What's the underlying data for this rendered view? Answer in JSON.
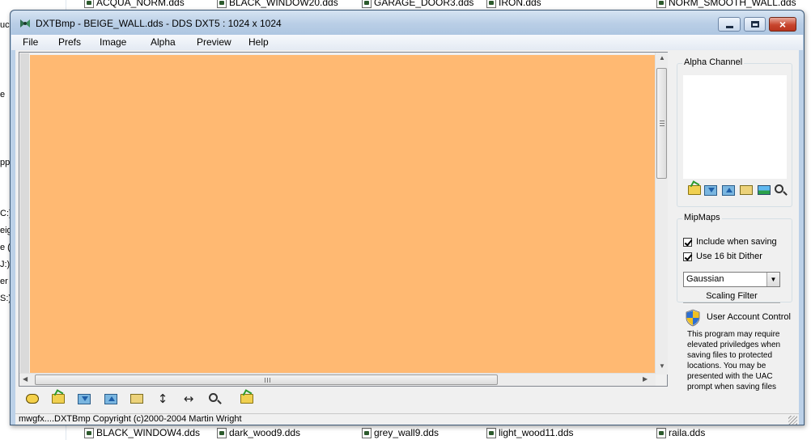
{
  "background": {
    "top_files": [
      "ACQUA_NORM.dds",
      "BLACK_WINDOW20.dds",
      "GARAGE_DOOR3.dds",
      "IRON.dds",
      "NORM_SMOOTH_WALL.dds"
    ],
    "bottom_files": [
      "BLACK_WINDOW4.dds",
      "dark_wood9.dds",
      "grey_wall9.dds",
      "light_wood11.dds",
      "raila.dds"
    ],
    "left_fragments": [
      "ucl",
      "e",
      "pp",
      "C:)",
      "eig",
      "e (",
      "J:)",
      "er",
      "S:)"
    ]
  },
  "window": {
    "title": "DXTBmp - BEIGE_WALL.dds - DDS DXT5 : 1024 x 1024",
    "close_glyph": "×"
  },
  "menu": [
    "File",
    "Prefs",
    "Image",
    "Alpha",
    "Preview",
    "Help"
  ],
  "image": {
    "fill_color": "#ffb972"
  },
  "toolbar": {
    "icons": [
      "bug-icon",
      "open-folder-icon",
      "save-image-icon",
      "load-image-icon",
      "open-file-icon",
      "flip-vertical-icon",
      "flip-horizontal-icon",
      "zoom-icon",
      "open-folder-icon"
    ],
    "flip_vertical_glyph": "↕",
    "flip_horizontal_glyph": "↔"
  },
  "alpha_channel": {
    "label": "Alpha Channel",
    "tools": [
      "open-alpha-icon",
      "save-alpha-icon",
      "load-alpha-icon",
      "open-alpha-file-icon",
      "view-alpha-icon",
      "zoom-alpha-icon"
    ]
  },
  "mipmaps": {
    "label": "MipMaps",
    "include_when_saving": {
      "label": "Include when saving",
      "checked": true
    },
    "use_16bit_dither": {
      "label": "Use 16 bit Dither",
      "checked": true
    },
    "scaling_filter_value": "Gaussian",
    "scaling_filter_label": "Scaling Filter"
  },
  "uac": {
    "title": "User Account Control",
    "body": "This program may require elevated priviledges when saving files to protected locations. You may be presented with the UAC prompt when saving files"
  },
  "status": {
    "text": "mwgfx....DXTBmp Copyright (c)2000-2004 Martin Wright"
  }
}
